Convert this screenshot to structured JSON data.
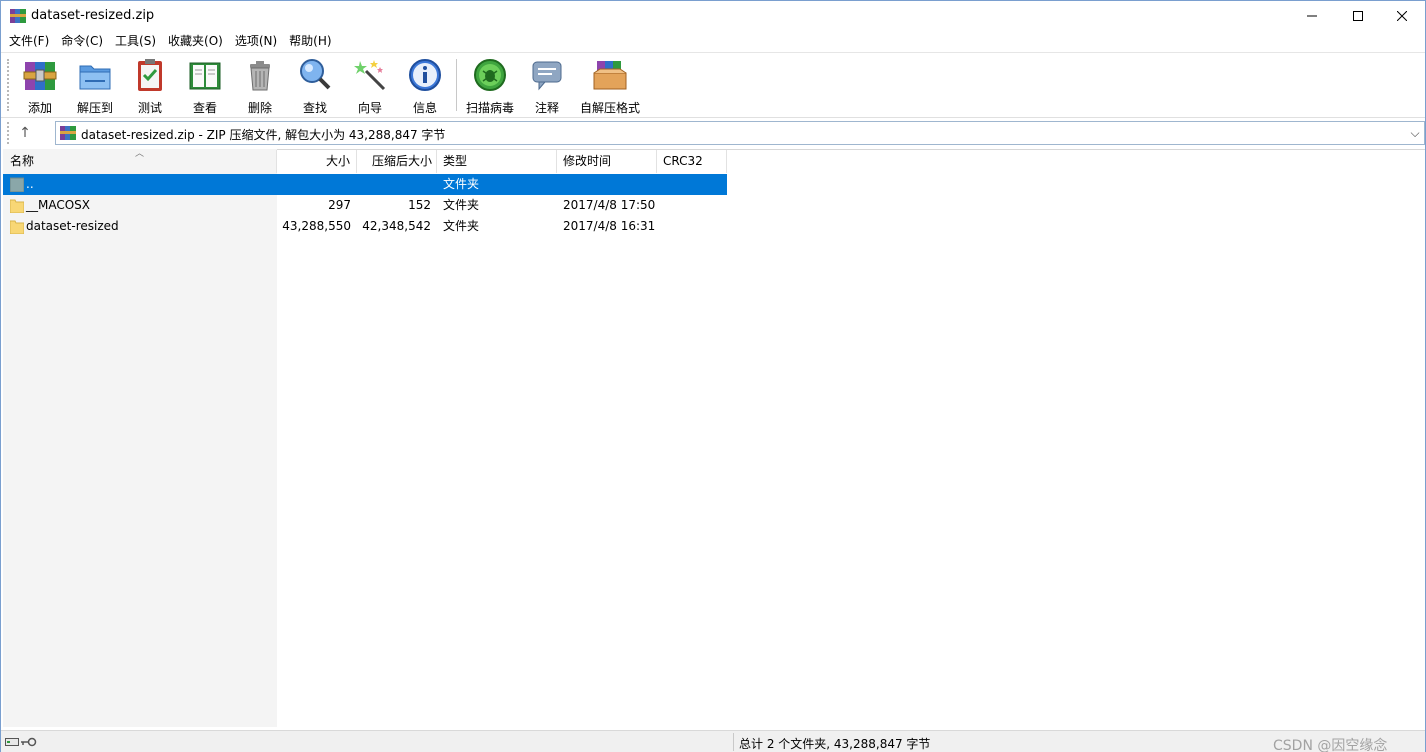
{
  "window": {
    "title": "dataset-resized.zip",
    "minimize_glyph": "—",
    "maximize_glyph": "☐",
    "close_glyph": "✕"
  },
  "menu": [
    "文件(F)",
    "命令(C)",
    "工具(S)",
    "收藏夹(O)",
    "选项(N)",
    "帮助(H)"
  ],
  "toolbar": {
    "buttons": [
      {
        "label": "添加",
        "icon": "archive-add-icon"
      },
      {
        "label": "解压到",
        "icon": "extract-folder-icon"
      },
      {
        "label": "测试",
        "icon": "test-clipboard-icon"
      },
      {
        "label": "查看",
        "icon": "view-book-icon"
      },
      {
        "label": "删除",
        "icon": "trash-icon"
      },
      {
        "label": "查找",
        "icon": "magnifier-icon"
      },
      {
        "label": "向导",
        "icon": "wizard-wand-icon"
      },
      {
        "label": "信息",
        "icon": "info-icon"
      },
      {
        "label": "扫描病毒",
        "icon": "virus-scan-icon"
      },
      {
        "label": "注释",
        "icon": "comment-icon"
      },
      {
        "label": "自解压格式",
        "icon": "sfx-box-icon"
      }
    ]
  },
  "address": {
    "up_glyph": "↑",
    "text": "dataset-resized.zip - ZIP 压缩文件, 解包大小为 43,288,847 字节",
    "dropdown_glyph": "⌵"
  },
  "columns": {
    "name": "名称",
    "size": "大小",
    "packed": "压缩后大小",
    "type": "类型",
    "modified": "修改时间",
    "crc": "CRC32"
  },
  "rows": [
    {
      "name": "..",
      "size": "",
      "packed": "",
      "type": "文件夹",
      "modified": "",
      "selected": true
    },
    {
      "name": "__MACOSX",
      "size": "297",
      "packed": "152",
      "type": "文件夹",
      "modified": "2017/4/8 17:50",
      "selected": false
    },
    {
      "name": "dataset-resized",
      "size": "43,288,550",
      "packed": "42,348,542",
      "type": "文件夹",
      "modified": "2017/4/8 16:31",
      "selected": false
    }
  ],
  "status": {
    "summary": "总计 2 个文件夹, 43,288,847 字节",
    "watermark": "CSDN @因空缘念"
  },
  "colors": {
    "selection": "#0078d7",
    "folder": "#f8d775",
    "left_pane": "#f4f4f4"
  }
}
